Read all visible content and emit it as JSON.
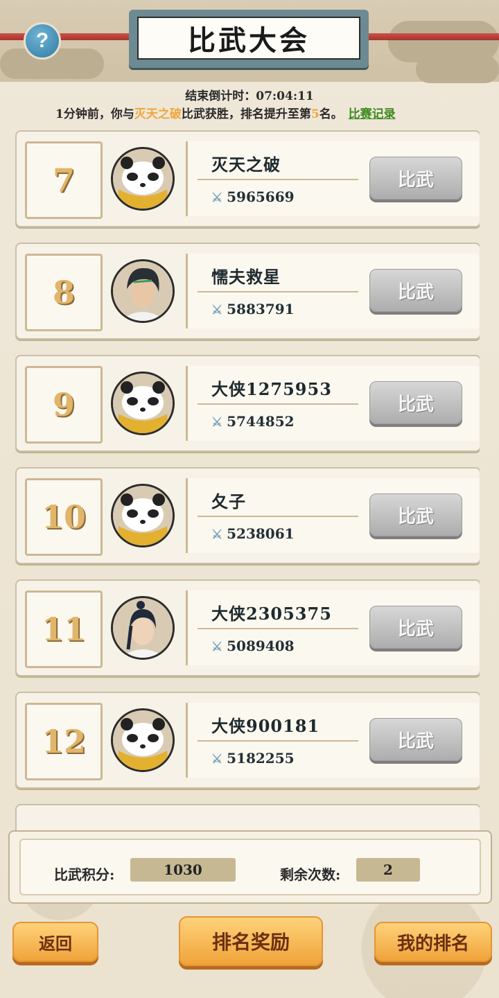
{
  "header": {
    "title": "比武大会",
    "help_symbol": "?"
  },
  "countdown": {
    "label": "结束倒计时：",
    "time": "07:04:11"
  },
  "notice": {
    "prefix": "1分钟前，你与",
    "opponent": "灭天之破",
    "middle": "比武获胜，排名提升至第",
    "rank": "5",
    "suffix": "名。",
    "record_link": "比赛记录"
  },
  "players": [
    {
      "rank": "7",
      "name": "灭天之破",
      "power": "5965669",
      "avatar": "panda",
      "button": "比武"
    },
    {
      "rank": "8",
      "name": "懦夫救星",
      "power": "5883791",
      "avatar": "swordsman",
      "button": "比武"
    },
    {
      "rank": "9",
      "name": "大侠1275953",
      "power": "5744852",
      "avatar": "panda",
      "button": "比武"
    },
    {
      "rank": "10",
      "name": "夂子",
      "power": "5238061",
      "avatar": "panda",
      "button": "比武"
    },
    {
      "rank": "11",
      "name": "大侠2305375",
      "power": "5089408",
      "avatar": "swordswoman",
      "button": "比武"
    },
    {
      "rank": "12",
      "name": "大侠900181",
      "power": "5182255",
      "avatar": "panda",
      "button": "比武"
    }
  ],
  "score": {
    "points_label": "比武积分:",
    "points_value": "1030",
    "remaining_label": "剩余次数:",
    "remaining_value": "2"
  },
  "buttons": {
    "back": "返回",
    "rewards": "排名奖励",
    "my_rank": "我的排名"
  },
  "colors": {
    "accent_orange": "#f0a33a",
    "highlight": "#f0a53a",
    "link_green": "#3f8a1f",
    "rank_gold": "#e1b56a"
  }
}
